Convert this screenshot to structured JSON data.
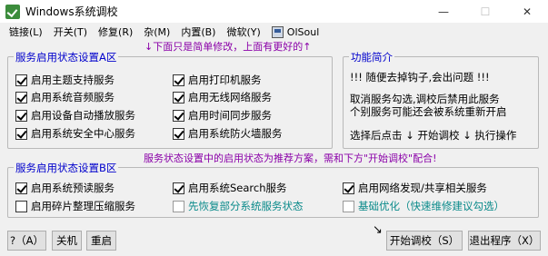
{
  "window": {
    "title": "Windows系统调校",
    "minimize": "—",
    "maximize": "☐",
    "close": "✕"
  },
  "menu": [
    "链接(L)",
    "开关(T)",
    "修复(R)",
    "杂(M)",
    "内置(B)",
    "微软(Y)",
    "OlSoul"
  ],
  "groupA": {
    "title": "服务启用状态设置A区",
    "notice": "↓下面只是简单修改，上面有更好的↑",
    "left": [
      "启用主题支持服务",
      "启用系统音频服务",
      "启用设备自动播放服务",
      "启用系统安全中心服务"
    ],
    "right": [
      "启用打印机服务",
      "启用无线网络服务",
      "启用时间同步服务",
      "启用系统防火墙服务"
    ]
  },
  "intro": {
    "title": "功能简介",
    "line1": "!!! 随便去掉钩子,会出问题 !!!",
    "line2": "取消服务勾选,调校后禁用此服务",
    "line3": "个别服务可能还会被系统重新开启",
    "line4": "选择后点击 ↓ 开始调校 ↓ 执行操作"
  },
  "groupB": {
    "title": "服务启用状态设置B区",
    "notice": "服务状态设置中的启用状态为推荐方案，需和下方\"开始调校\"配合!",
    "row1": [
      "启用系统预读服务",
      "启用系统Search服务",
      "启用网络发现/共享相关服务"
    ],
    "row2": [
      "启用碎片整理压缩服务",
      "先恢复部分系统服务状态",
      "基础优化（快速维修建议勾选）"
    ]
  },
  "buttons": {
    "help": "?（A）",
    "shutdown": "关机",
    "restart": "重启",
    "arrow": "↘",
    "start": "开始调校（S）",
    "exit": "退出程序（X）"
  }
}
